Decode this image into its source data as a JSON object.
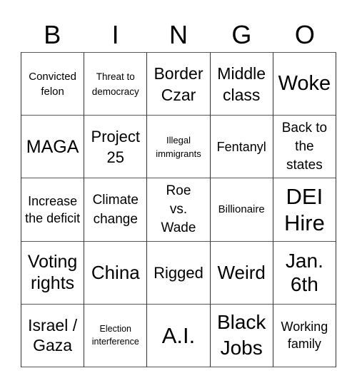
{
  "header": {
    "letters": [
      "B",
      "I",
      "N",
      "G",
      "O"
    ]
  },
  "cells": [
    "Convicted felon",
    "Threat to democracy",
    "Border Czar",
    "Middle class",
    "Woke",
    "MAGA",
    "Project 25",
    "Illegal immigrants",
    "Fentanyl",
    "Back to the states",
    "Increase the deficit",
    "Climate change",
    "Roe vs. Wade",
    "Billionaire",
    "DEI Hire",
    "Voting rights",
    "China",
    "Rigged",
    "Weird",
    "Jan. 6th",
    "Israel / Gaza",
    "Election interference",
    "A.I.",
    "Black Jobs",
    "Working family"
  ]
}
